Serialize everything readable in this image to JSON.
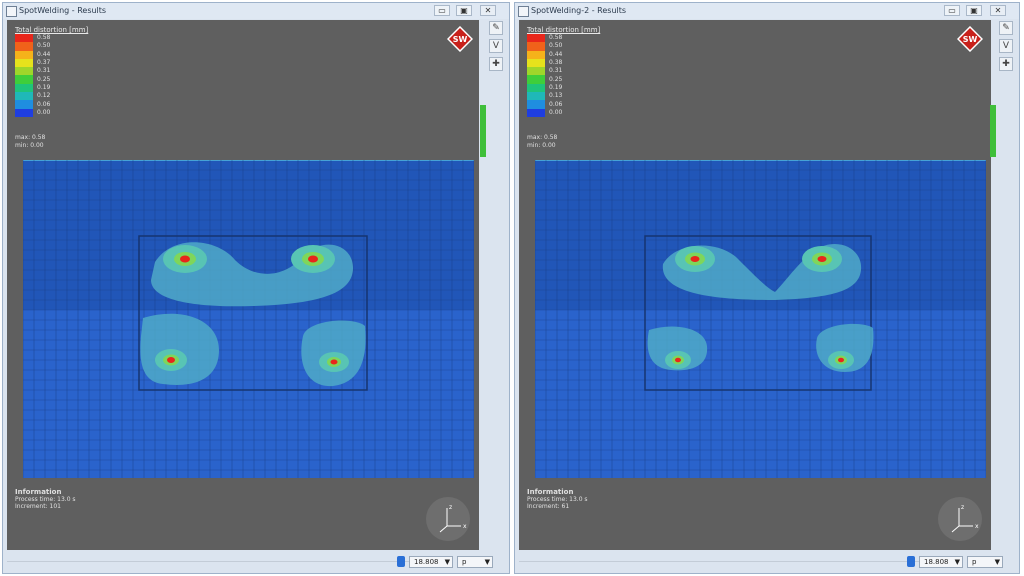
{
  "windows": [
    {
      "title": "SpotWelding - Results",
      "legend_title": "Total distortion [mm]",
      "legend": [
        {
          "value": "0.58",
          "color": "#e8261a"
        },
        {
          "value": "0.50",
          "color": "#f0621a"
        },
        {
          "value": "0.44",
          "color": "#f5b21a"
        },
        {
          "value": "0.37",
          "color": "#e6e21c"
        },
        {
          "value": "0.31",
          "color": "#9fd62a"
        },
        {
          "value": "0.25",
          "color": "#3fce3a"
        },
        {
          "value": "0.19",
          "color": "#1fc47a"
        },
        {
          "value": "0.12",
          "color": "#1fb8b8"
        },
        {
          "value": "0.06",
          "color": "#1f8ee0"
        },
        {
          "value": "0.00",
          "color": "#1f3ee0"
        }
      ],
      "max_label": "max: 0.58",
      "min_label": "min: 0.00",
      "info_heading": "Information",
      "info_lines": [
        "Process time: 13.0 s",
        "Increment: 101"
      ],
      "zoom": "18.808",
      "axis_select": "p"
    },
    {
      "title": "SpotWelding-2 - Results",
      "legend_title": "Total distortion [mm]",
      "legend": [
        {
          "value": "0.58",
          "color": "#e8261a"
        },
        {
          "value": "0.50",
          "color": "#f0621a"
        },
        {
          "value": "0.44",
          "color": "#f5b21a"
        },
        {
          "value": "0.38",
          "color": "#e6e21c"
        },
        {
          "value": "0.31",
          "color": "#9fd62a"
        },
        {
          "value": "0.25",
          "color": "#3fce3a"
        },
        {
          "value": "0.19",
          "color": "#1fc47a"
        },
        {
          "value": "0.13",
          "color": "#1fb8b8"
        },
        {
          "value": "0.06",
          "color": "#1f8ee0"
        },
        {
          "value": "0.00",
          "color": "#1f3ee0"
        }
      ],
      "max_label": "max: 0.58",
      "min_label": "min: 0.00",
      "info_heading": "Information",
      "info_lines": [
        "Process time: 13.0 s",
        "Increment: 61"
      ],
      "zoom": "18.808",
      "axis_select": "p"
    }
  ],
  "logo_text": "SW",
  "window_buttons": [
    "▭",
    "▣",
    "✕"
  ],
  "side_tools": [
    "✎",
    "V",
    "✚"
  ],
  "colors": {
    "mesh_dark": "#2156b8",
    "mesh_light": "#2a63cc",
    "grid": "#1a3f86",
    "hotspot": "#e8261a",
    "halo": "#4fb8c8"
  }
}
